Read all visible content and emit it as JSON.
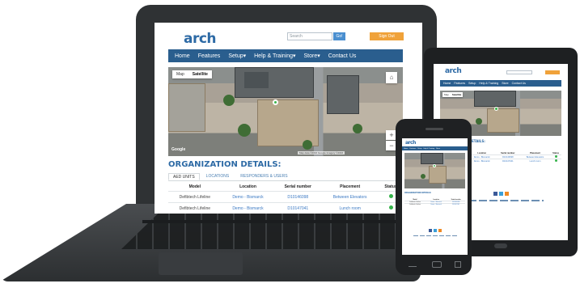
{
  "brand": {
    "logo": "arch"
  },
  "header": {
    "search_placeholder": "Search",
    "go_label": "Go!",
    "signout_label": "Sign Out"
  },
  "nav": [
    {
      "label": "Home"
    },
    {
      "label": "Features"
    },
    {
      "label": "Setup",
      "caret": "▾"
    },
    {
      "label": "Help & Training",
      "caret": "▾"
    },
    {
      "label": "Store",
      "caret": "▾"
    },
    {
      "label": "Contact Us"
    }
  ],
  "map": {
    "tab_map": "Map",
    "tab_satellite": "Satellite",
    "zoom_in": "+",
    "zoom_out": "−",
    "google": "Google",
    "attribution": "Map data ©2016 Google Imagery ©2016"
  },
  "org": {
    "title": "ORGANIZATION DETAILS:",
    "tabs": [
      "AED UNITS",
      "LOCATIONS",
      "RESPONDERS & USERS"
    ],
    "columns": [
      "Model",
      "Location",
      "Serial number",
      "Placement",
      "Status"
    ],
    "rows": [
      {
        "model": "Defibtech Lifeline",
        "location": "Demo - Bismarck",
        "serial": "D10146098",
        "placement": "Between Elevators",
        "status": "ok"
      },
      {
        "model": "Defibtech Lifeline",
        "location": "Demo - Bismarck",
        "serial": "D10147041",
        "placement": "Lunch room",
        "status": "ok"
      }
    ]
  },
  "colors": {
    "nav_bg": "#2a5e8e",
    "accent_blue": "#2d6aa5",
    "signout_orange": "#f0a23a",
    "status_green": "#35b34a"
  }
}
